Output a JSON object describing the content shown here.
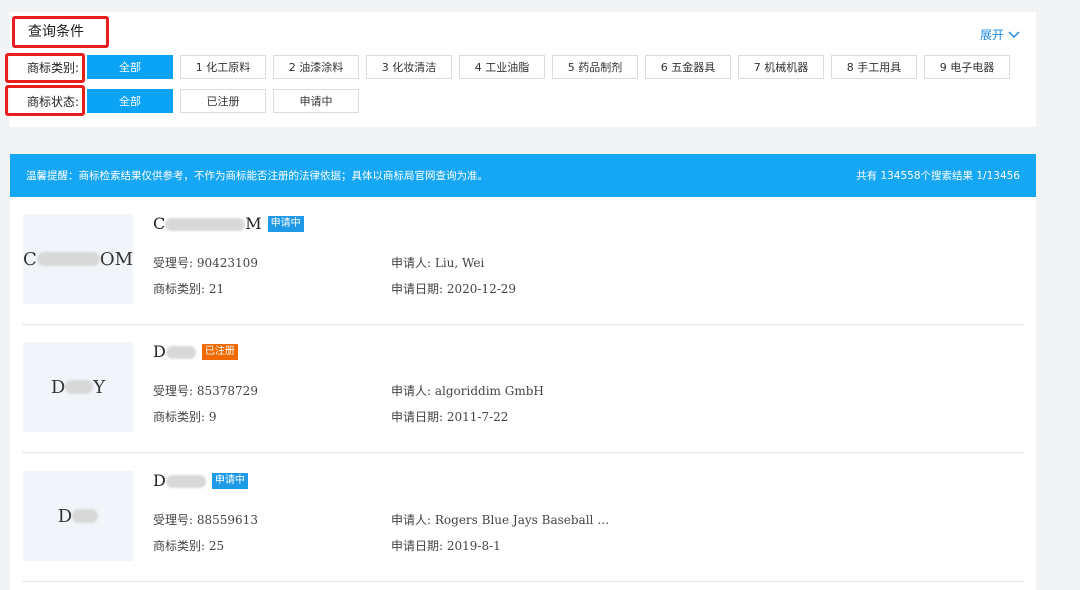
{
  "filter": {
    "title": "查询条件",
    "expand_label": "展开",
    "category": {
      "label": "商标类别:",
      "options": [
        "全部",
        "1 化工原料",
        "2 油漆涂料",
        "3 化妆清洁",
        "4 工业油脂",
        "5 药品制剂",
        "6 五金器具",
        "7 机械机器",
        "8 手工用具",
        "9 电子电器"
      ],
      "selected": "全部"
    },
    "status": {
      "label": "商标状态:",
      "options": [
        "全部",
        "已注册",
        "申请中"
      ],
      "selected": "全部"
    }
  },
  "notice": {
    "text": "温馨提醒：商标检索结果仅供参考，不作为商标能否注册的法律依据；具体以商标局官网查询为准。",
    "result_count": "共有 134558个搜索结果 1/13456"
  },
  "labels": {
    "reg_no": "受理号:",
    "class": "商标类别:",
    "applicant": "申请人:",
    "apply_date": "申请日期:"
  },
  "results": [
    {
      "name_start": "C",
      "name_end": "M",
      "thumb_start": "C",
      "thumb_end": "OM",
      "status": "申请中",
      "reg_no": "90423109",
      "class": "21",
      "applicant": "Liu, Wei",
      "apply_date": "2020-12-29"
    },
    {
      "name_start": "D",
      "name_end": "",
      "thumb_start": "D",
      "thumb_end": "Y",
      "status": "已注册",
      "reg_no": "85378729",
      "class": "9",
      "applicant": "algoriddim GmbH",
      "apply_date": "2011-7-22"
    },
    {
      "name_start": "D",
      "name_end": "",
      "thumb_start": "D",
      "thumb_end": "",
      "status": "申请中",
      "reg_no": "88559613",
      "class": "25",
      "applicant": "Rogers Blue Jays Baseball …",
      "apply_date": "2019-8-1"
    }
  ],
  "colors": {
    "accent": "#0aa3f5",
    "pending": "#1e9ae6",
    "registered": "#f06a00",
    "highlight": "#e81e1e"
  }
}
